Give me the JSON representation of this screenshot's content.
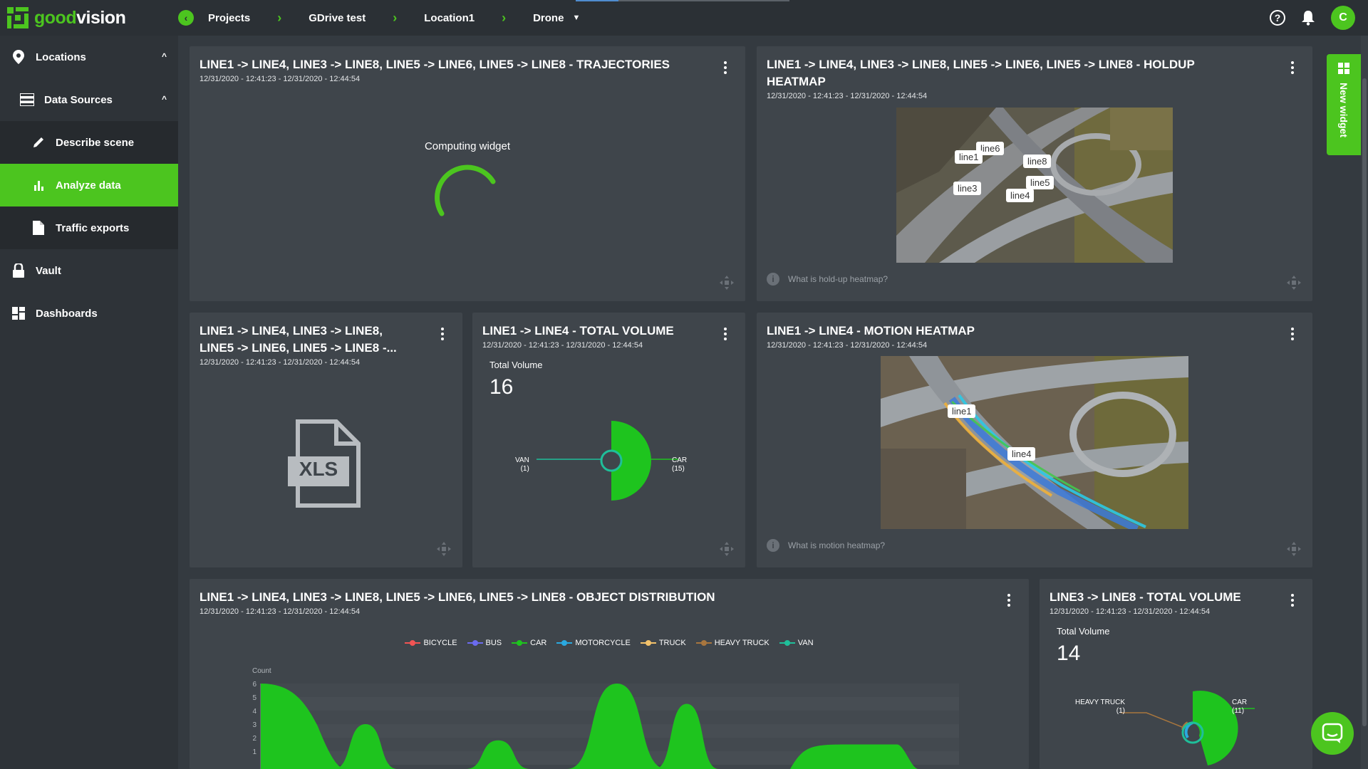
{
  "app": {
    "logo_good": "good",
    "logo_vision": "vision"
  },
  "breadcrumb": [
    "Projects",
    "GDrive test",
    "Location1",
    "Drone"
  ],
  "user": {
    "initial": "C"
  },
  "sidebar": {
    "items": [
      {
        "label": "Locations"
      },
      {
        "label": "Data Sources"
      },
      {
        "label": "Describe scene"
      },
      {
        "label": "Analyze data"
      },
      {
        "label": "Traffic exports"
      },
      {
        "label": "Vault"
      },
      {
        "label": "Dashboards"
      }
    ]
  },
  "new_widget_label": "New widget",
  "date_range": "12/31/2020 - 12:41:23 - 12/31/2020 - 12:44:54",
  "widgets": {
    "trajectories": {
      "title": "LINE1 -> LINE4, LINE3 -> LINE8, LINE5 -> LINE6, LINE5 -> LINE8 - TRAJECTORIES",
      "status": "Computing widget"
    },
    "holdup": {
      "title_l1": "LINE1 -> LINE4, LINE3 -> LINE8, LINE5 -> LINE6, LINE5 -> LINE8 - HOLDUP",
      "title_l2": "HEATMAP",
      "labels": [
        "line6",
        "line1",
        "line8",
        "line3",
        "line5",
        "line4"
      ],
      "info": "What is hold-up heatmap?"
    },
    "export": {
      "title_l1": "LINE1 -> LINE4, LINE3 -> LINE8,",
      "title_l2": "LINE5 -> LINE6, LINE5 -> LINE8 -...",
      "file_type": "XLS"
    },
    "volume14": {
      "title": "LINE1 -> LINE4 - TOTAL VOLUME",
      "total_label": "Total Volume",
      "total_value": "16",
      "left_label": "VAN",
      "left_count": "(1)",
      "right_label": "CAR",
      "right_count": "(15)"
    },
    "motion": {
      "title": "LINE1 -> LINE4 - MOTION HEATMAP",
      "labels": [
        "line1",
        "line4"
      ],
      "info": "What is motion heatmap?"
    },
    "distribution": {
      "title": "LINE1 -> LINE4, LINE3 -> LINE8, LINE5 -> LINE6, LINE5 -> LINE8 - OBJECT DISTRIBUTION",
      "ylabel": "Count"
    },
    "volume38": {
      "title": "LINE3 -> LINE8 - TOTAL VOLUME",
      "total_label": "Total Volume",
      "total_value": "14",
      "left_label": "HEAVY TRUCK",
      "left_count": "(1)",
      "right_label": "CAR",
      "right_count": "(11)"
    }
  },
  "chart_data": {
    "type": "area",
    "ylabel": "Count",
    "yticks": [
      1,
      2,
      3,
      4,
      5,
      6
    ],
    "ylim": [
      0,
      6
    ],
    "legend_position": "top-center",
    "series": [
      {
        "name": "BICYCLE",
        "color": "#f25454"
      },
      {
        "name": "BUS",
        "color": "#6b6bf0"
      },
      {
        "name": "CAR",
        "color": "#1ec41e"
      },
      {
        "name": "MOTORCYCLE",
        "color": "#2aa9e0"
      },
      {
        "name": "TRUCK",
        "color": "#f3c26b"
      },
      {
        "name": "HEAVY TRUCK",
        "color": "#a8763e"
      },
      {
        "name": "VAN",
        "color": "#1fbf9a"
      }
    ],
    "car_peaks": [
      {
        "x": 0.0,
        "y": 6
      },
      {
        "x": 0.15,
        "y": 3
      },
      {
        "x": 0.34,
        "y": 1.8
      },
      {
        "x": 0.51,
        "y": 6
      },
      {
        "x": 0.61,
        "y": 4.5
      },
      {
        "x": 0.85,
        "y": 1.5
      }
    ]
  },
  "colors": {
    "accent": "#4cc51f",
    "bg": "#343a40",
    "card": "#3f454b"
  }
}
